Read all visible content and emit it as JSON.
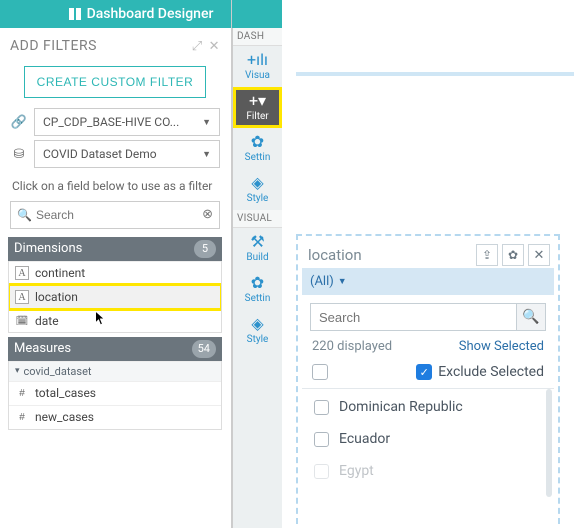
{
  "title": "Dashboard Designer",
  "filters_panel": {
    "header": "ADD FILTERS",
    "create_button": "CREATE CUSTOM FILTER",
    "connection": "CP_CDP_BASE-HIVE CO...",
    "dataset": "COVID Dataset Demo",
    "hint": "Click on a field below to use as a filter",
    "search_placeholder": "Search",
    "dimensions": {
      "label": "Dimensions",
      "count": "5",
      "fields": [
        "continent",
        "location",
        "date"
      ]
    },
    "measures": {
      "label": "Measures",
      "count": "54",
      "group": "covid_dataset",
      "fields": [
        "total_cases",
        "new_cases"
      ]
    }
  },
  "right_tabs": {
    "group1_head": "DASH",
    "group2_head": "VISUAL",
    "items": [
      {
        "icon": "+ılı",
        "label": "Visua"
      },
      {
        "icon": "+▾",
        "label": "Filter"
      },
      {
        "icon": "✿",
        "label": "Settin"
      },
      {
        "icon": "◈",
        "label": "Style"
      },
      {
        "icon": "⚒",
        "label": "Build"
      },
      {
        "icon": "✿",
        "label": "Settin"
      },
      {
        "icon": "◈",
        "label": "Style"
      }
    ]
  },
  "filter_popup": {
    "title": "location",
    "all_label": "(All)",
    "search_placeholder": "Search",
    "displayed_text": "220 displayed",
    "show_selected": "Show Selected",
    "exclude_label": "Exclude Selected",
    "items": [
      "Dominican Republic",
      "Ecuador",
      "Egypt"
    ]
  }
}
